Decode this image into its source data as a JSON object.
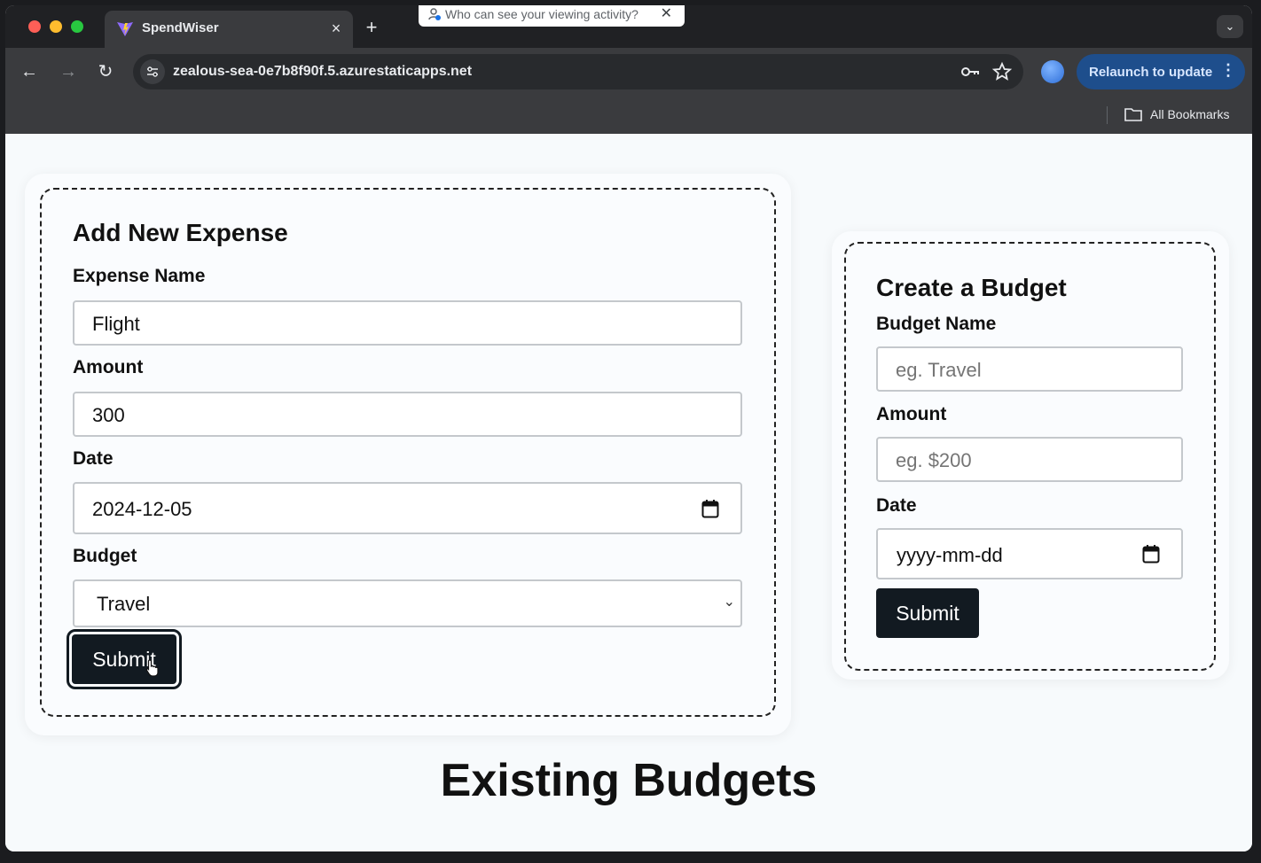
{
  "browser": {
    "tab_title": "SpendWiser",
    "tab_close": "×",
    "new_tab": "+",
    "tab_menu": "⌄",
    "popup_text": "Who can see your viewing activity?",
    "popup_close": "✕",
    "back": "←",
    "forward": "→",
    "reload": "↻",
    "url": "zealous-sea-0e7b8f90f.5.azurestaticapps.net",
    "relaunch_label": "Relaunch to update",
    "relaunch_menu": "⋮",
    "bookmarks_label": "All Bookmarks"
  },
  "expense_form": {
    "title": "Add New Expense",
    "name_label": "Expense Name",
    "name_value": "Flight",
    "amount_label": "Amount",
    "amount_value": "300",
    "date_label": "Date",
    "date_value": "2024-12-05",
    "budget_label": "Budget",
    "budget_value": "Travel",
    "submit_label": "Submit"
  },
  "budget_form": {
    "title": "Create a Budget",
    "name_label": "Budget Name",
    "name_placeholder": "eg. Travel",
    "amount_label": "Amount",
    "amount_placeholder": "eg. $200",
    "date_label": "Date",
    "date_placeholder": "yyyy-mm-dd",
    "submit_label": "Submit"
  },
  "existing_budgets": {
    "title": "Existing Budgets"
  }
}
